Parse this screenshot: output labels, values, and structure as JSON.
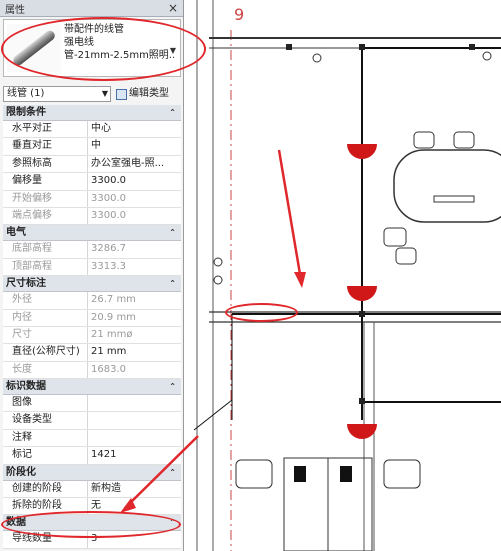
{
  "palette": {
    "title": "属性",
    "close_icon": "×",
    "type_selector": {
      "line1": "带配件的线管",
      "line2": "强电线",
      "line3": "管-21mm-2.5mm照明..."
    },
    "filter": "线管 (1)",
    "edit_type": "编辑类型",
    "categories": [
      {
        "name": "限制条件",
        "rows": [
          {
            "label": "水平对正",
            "value": "中心",
            "dim": false
          },
          {
            "label": "垂直对正",
            "value": "中",
            "dim": false
          },
          {
            "label": "参照标高",
            "value": "办公室强电-照...",
            "dim": false
          },
          {
            "label": "偏移量",
            "value": "3300.0",
            "dim": false
          },
          {
            "label": "开始偏移",
            "value": "3300.0",
            "dim": true
          },
          {
            "label": "端点偏移",
            "value": "3300.0",
            "dim": true
          }
        ]
      },
      {
        "name": "电气",
        "rows": [
          {
            "label": "底部高程",
            "value": "3286.7",
            "dim": true
          },
          {
            "label": "顶部高程",
            "value": "3313.3",
            "dim": true
          }
        ]
      },
      {
        "name": "尺寸标注",
        "rows": [
          {
            "label": "外径",
            "value": "26.7 mm",
            "dim": true
          },
          {
            "label": "内径",
            "value": "20.9 mm",
            "dim": true
          },
          {
            "label": "尺寸",
            "value": "21 mmø",
            "dim": true
          },
          {
            "label": "直径(公称尺寸)",
            "value": "21 mm",
            "dim": false
          },
          {
            "label": "长度",
            "value": "1683.0",
            "dim": true
          }
        ]
      },
      {
        "name": "标识数据",
        "rows": [
          {
            "label": "图像",
            "value": "",
            "dim": false
          },
          {
            "label": "设备类型",
            "value": "",
            "dim": false
          },
          {
            "label": "注释",
            "value": "",
            "dim": false
          },
          {
            "label": "标记",
            "value": "1421",
            "dim": false
          }
        ]
      },
      {
        "name": "阶段化",
        "rows": [
          {
            "label": "创建的阶段",
            "value": "新构造",
            "dim": false
          },
          {
            "label": "拆除的阶段",
            "value": "无",
            "dim": false
          }
        ]
      },
      {
        "name": "数据",
        "rows": [
          {
            "label": "导线数量",
            "value": "3",
            "dim": false
          }
        ]
      }
    ]
  },
  "drawing": {
    "grid_label": "9"
  },
  "colors": {
    "annotation": "#e0272b",
    "category_bg": "#dfe3ea"
  }
}
